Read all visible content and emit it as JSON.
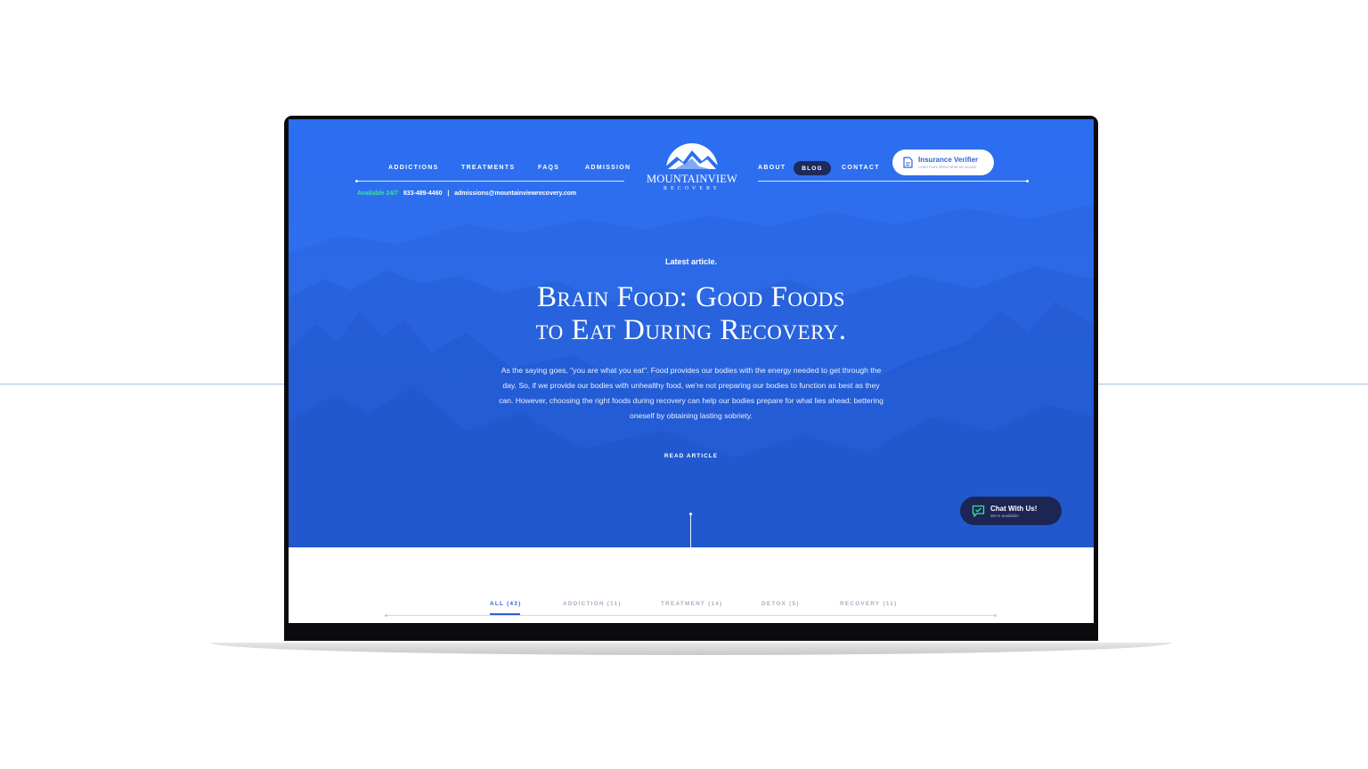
{
  "nav": {
    "left_items": [
      "ADDICTIONS",
      "TREATMENTS",
      "FAQS",
      "ADMISSION"
    ],
    "right_items": [
      "ABOUT",
      "BLOG",
      "CONTACT"
    ],
    "active": "BLOG"
  },
  "contact": {
    "availability": "Available 24/7",
    "phone": "833-489-4460",
    "separator": "|",
    "email": "admissions@mountainviewrecovery.com"
  },
  "logo": {
    "name": "MOUNTAINVIEW",
    "subtitle": "RECOVERY"
  },
  "insurance": {
    "title": "Insurance Verifier",
    "subtitle": "Learn more about what we accept",
    "icon": "document-icon"
  },
  "hero": {
    "eyebrow": "Latest article.",
    "headline_line1": "Brain Food: Good Foods",
    "headline_line2": "to Eat During Recovery.",
    "lede": "As the saying goes, \"you are what you eat\". Food provides our bodies with the energy needed to get through the day. So, if we provide our bodies with unhealthy food, we're not preparing our bodies to function as best as they can. However, choosing the right foods during recovery can help our bodies prepare for what lies ahead; bettering oneself by obtaining lasting sobriety.",
    "cta": "READ ARTICLE",
    "bg_color": "#2b6ef0"
  },
  "chat": {
    "title": "Chat With Us!",
    "subtitle": "We're available!",
    "icon": "chat-check-icon"
  },
  "categories": [
    {
      "label": "ALL  (43)",
      "active": true
    },
    {
      "label": "ADDICTION  (11)",
      "active": false
    },
    {
      "label": "TREATMENT  (14)",
      "active": false
    },
    {
      "label": "DETOX  (5)",
      "active": false
    },
    {
      "label": "RECOVERY  (11)",
      "active": false
    }
  ],
  "colors": {
    "accent": "#2d63d9",
    "navy": "#1f2a5c",
    "green": "#3de0a0"
  }
}
